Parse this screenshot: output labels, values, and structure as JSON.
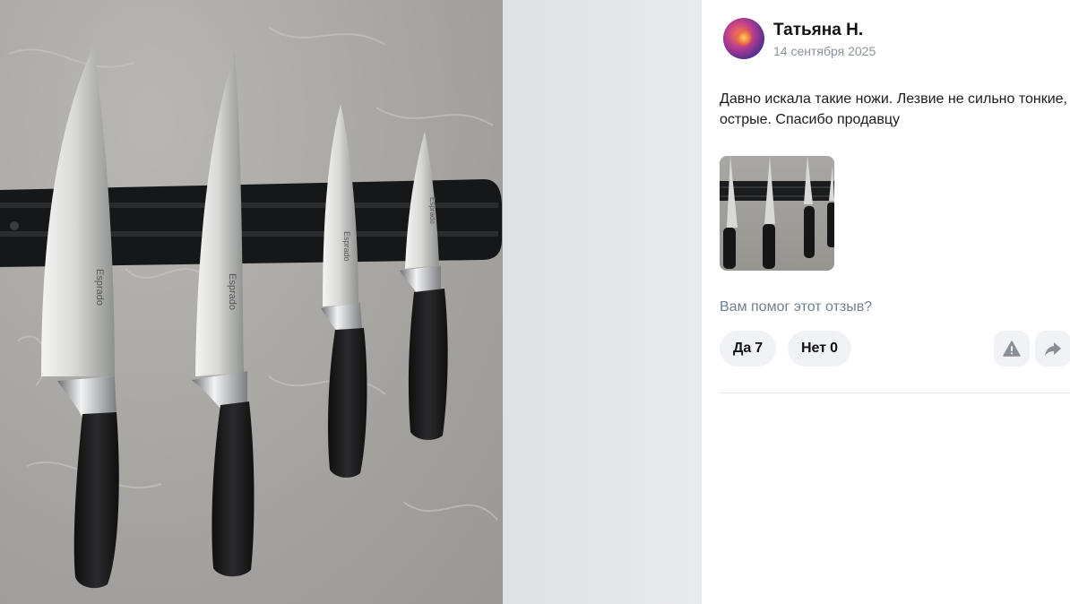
{
  "review": {
    "author_name": "Татьяна Н.",
    "date": "14 сентября 2025",
    "text": "Давно искала такие ножи. Лезвие не сильно тонкие, острые. Спасибо продавцу"
  },
  "photo": {
    "brand_label": "Esprado"
  },
  "helpful": {
    "question": "Вам помог этот отзыв?",
    "yes_label": "Да",
    "yes_count": "7",
    "no_label": "Нет",
    "no_count": "0"
  },
  "actions": {
    "complain_icon": "warning-icon",
    "share_icon": "share-arrow-icon"
  },
  "colors": {
    "muted_text": "#8c929c",
    "question_text": "#6f7f93",
    "button_bg": "#f1f2f5",
    "icon_gray": "#8a8f97"
  }
}
